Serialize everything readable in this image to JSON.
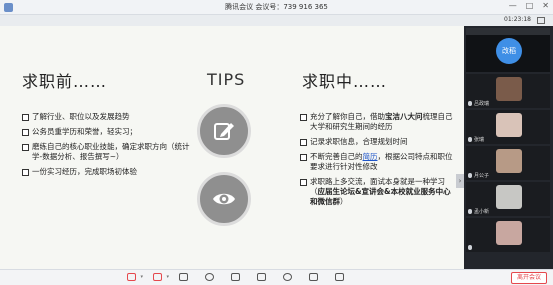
{
  "window": {
    "title": "腾讯会议 会议号：739 916 365",
    "controls": [
      "—",
      "□",
      "✕"
    ]
  },
  "subbar": {
    "time": "01:23:18"
  },
  "slide": {
    "left_heading": "求职前……",
    "center_heading": "TIPS",
    "right_heading": "求职中……",
    "left_bullets": [
      "了解行业、职位以及发展趋势",
      "公务员重学历和荣誉，轻实习；",
      "磨练自己的核心职业技能，确定求职方向（统计学-数据分析、报告撰写~）",
      "一份实习经历，完成职场初体验"
    ],
    "right_bullets": [
      {
        "pre": "充分了解你自己，借助",
        "bold": "宝洁八大问",
        "post": "梳理自己大学和研究生期间的经历"
      },
      {
        "pre": "记录求职信息，合理规划时间",
        "bold": "",
        "post": ""
      },
      {
        "pre": "不断完善自己的",
        "link": "简历",
        "post": "，根据公司特点和职位要求进行针对性修改"
      },
      {
        "pre": "求职路上多交流，面试本身就是一种学习（",
        "bold": "应届生论坛&宣讲会&本校就业服务中心和微信群",
        "post": "）"
      }
    ],
    "icons": [
      "edit-icon",
      "eye-icon"
    ]
  },
  "participants": {
    "self_label": "改稻",
    "tiles": [
      {
        "name": "吕政瑞",
        "color": "#7a5b4a"
      },
      {
        "name": "张瑞",
        "color": "#d9c3b8"
      },
      {
        "name": "月公子",
        "color": "#b79a86"
      },
      {
        "name": "孟小新",
        "color": "#c7c7c4"
      },
      {
        "name": "",
        "color": "#c8a7a0"
      }
    ]
  },
  "bottombar": {
    "leave_label": "离开会议"
  }
}
